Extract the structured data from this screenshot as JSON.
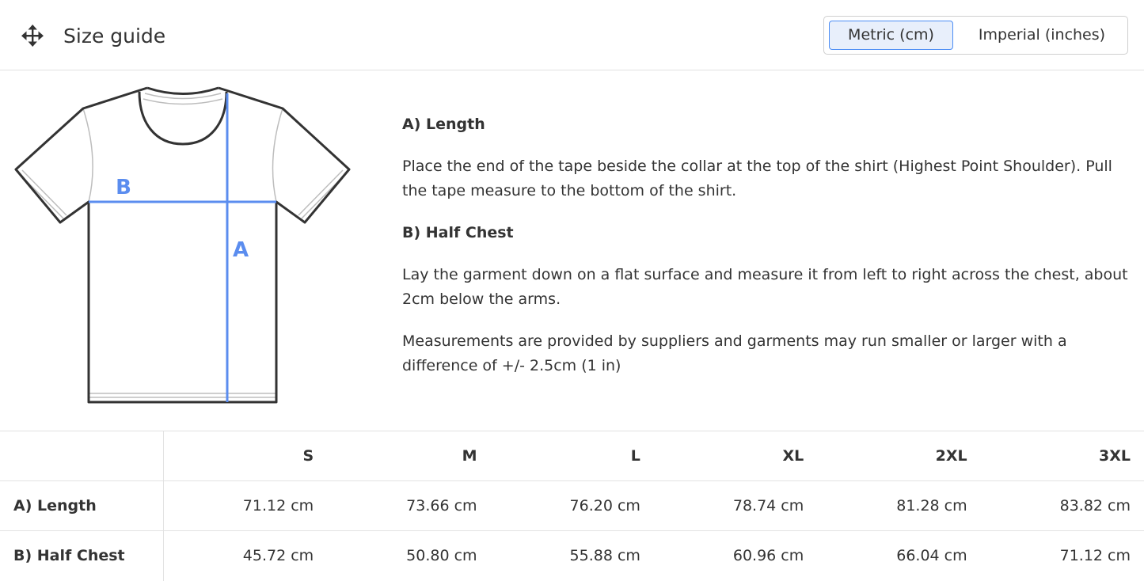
{
  "header": {
    "title": "Size guide",
    "move_icon": "move-arrows-icon"
  },
  "units": {
    "metric_label": "Metric (cm)",
    "imperial_label": "Imperial (inches)",
    "selected": "metric"
  },
  "diagram": {
    "label_a": "A",
    "label_b": "B",
    "accent_color": "#5b8def"
  },
  "description": {
    "length_heading": "A) Length",
    "length_text": "Place the end of the tape beside the collar at the top of the shirt (Highest Point Shoulder). Pull the tape measure to the bottom of the shirt.",
    "chest_heading": "B) Half Chest",
    "chest_text": "Lay the garment down on a flat surface and measure it from left to right across the chest, about 2cm below the arms.",
    "note": "Measurements are provided by suppliers and garments may run smaller or larger with a difference of +/- 2.5cm (1 in)"
  },
  "table": {
    "sizes": [
      "S",
      "M",
      "L",
      "XL",
      "2XL",
      "3XL"
    ],
    "rows": [
      {
        "label": "A) Length",
        "values": [
          "71.12 cm",
          "73.66 cm",
          "76.20 cm",
          "78.74 cm",
          "81.28 cm",
          "83.82 cm"
        ]
      },
      {
        "label": "B) Half Chest",
        "values": [
          "45.72 cm",
          "50.80 cm",
          "55.88 cm",
          "60.96 cm",
          "66.04 cm",
          "71.12 cm"
        ]
      }
    ]
  }
}
